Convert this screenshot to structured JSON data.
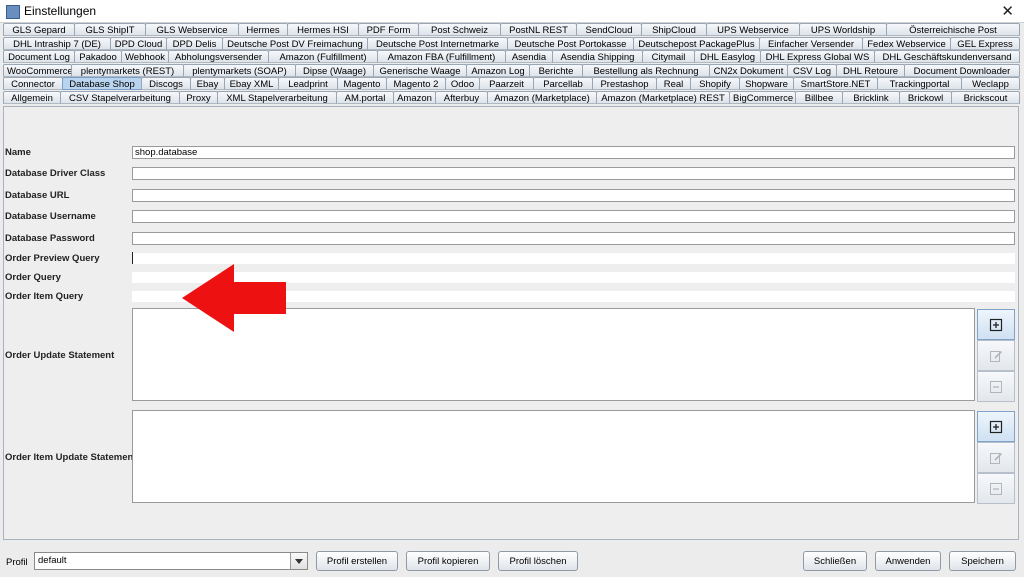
{
  "window": {
    "title": "Einstellungen"
  },
  "tab_rows": [
    [
      "GLS Gepard",
      "GLS ShipIT",
      "GLS Webservice",
      "Hermes",
      "Hermes HSI",
      "PDF Form",
      "Post Schweiz",
      "PostNL REST",
      "SendCloud",
      "ShipCloud",
      "UPS Webservice",
      "UPS Worldship",
      "Österreichische Post"
    ],
    [
      "DHL Intraship 7 (DE)",
      "DPD Cloud",
      "DPD Delis",
      "Deutsche Post DV Freimachung",
      "Deutsche Post Internetmarke",
      "Deutsche Post Portokasse",
      "Deutschepost PackagePlus",
      "Einfacher Versender",
      "Fedex Webservice",
      "GEL Express"
    ],
    [
      "Document Log",
      "Pakadoo",
      "Webhook",
      "Abholungsversender",
      "Amazon (Fulfillment)",
      "Amazon FBA (Fulfillment)",
      "Asendia",
      "Asendia Shipping",
      "Citymail",
      "DHL Easylog",
      "DHL Express Global WS",
      "DHL Geschäftskundenversand"
    ],
    [
      "WooCommerce",
      "plentymarkets (REST)",
      "plentymarkets (SOAP)",
      "Dipse (Waage)",
      "Generische Waage",
      "Amazon Log",
      "Berichte",
      "Bestellung als Rechnung",
      "CN2x Dokument",
      "CSV Log",
      "DHL Retoure",
      "Document Downloader"
    ],
    [
      "Connector",
      "Database Shop",
      "Discogs",
      "Ebay",
      "Ebay XML",
      "Leadprint",
      "Magento",
      "Magento 2",
      "Odoo",
      "Paarzeit",
      "Parcellab",
      "Prestashop",
      "Real",
      "Shopify",
      "Shopware",
      "SmartStore.NET",
      "Trackingportal",
      "Weclapp"
    ],
    [
      "Allgemein",
      "CSV Stapelverarbeitung",
      "Proxy",
      "XML Stapelverarbeitung",
      "AM.portal",
      "Amazon",
      "Afterbuy",
      "Amazon (Marketplace)",
      "Amazon (Marketplace) REST",
      "BigCommerce",
      "Billbee",
      "Bricklink",
      "Brickowl",
      "Brickscout"
    ]
  ],
  "active_tab": "Database Shop",
  "form": {
    "name_label": "Name",
    "name_value": "shop.database",
    "driver_label": "Database Driver Class",
    "driver_value": "",
    "url_label": "Database URL",
    "url_value": "",
    "username_label": "Database Username",
    "username_value": "",
    "password_label": "Database Password",
    "password_value": "",
    "preview_query_label": "Order Preview Query",
    "order_query_label": "Order Query",
    "item_query_label": "Order Item Query",
    "update_label": "Order Update Statement",
    "item_update_label": "Order Item Update Statement"
  },
  "footer": {
    "profil_label": "Profil",
    "profil_value": "default",
    "create_label": "Profil erstellen",
    "copy_label": "Profil kopieren",
    "delete_label": "Profil löschen",
    "close_label": "Schließen",
    "apply_label": "Anwenden",
    "save_label": "Speichern"
  },
  "colors": {
    "active_tab": "#b8d4ee",
    "arrow": "#ee1111",
    "panel_bg": "#eeeeee"
  },
  "icons": {
    "add": "plus-square-icon",
    "edit": "edit-icon",
    "remove": "minus-square-icon"
  }
}
